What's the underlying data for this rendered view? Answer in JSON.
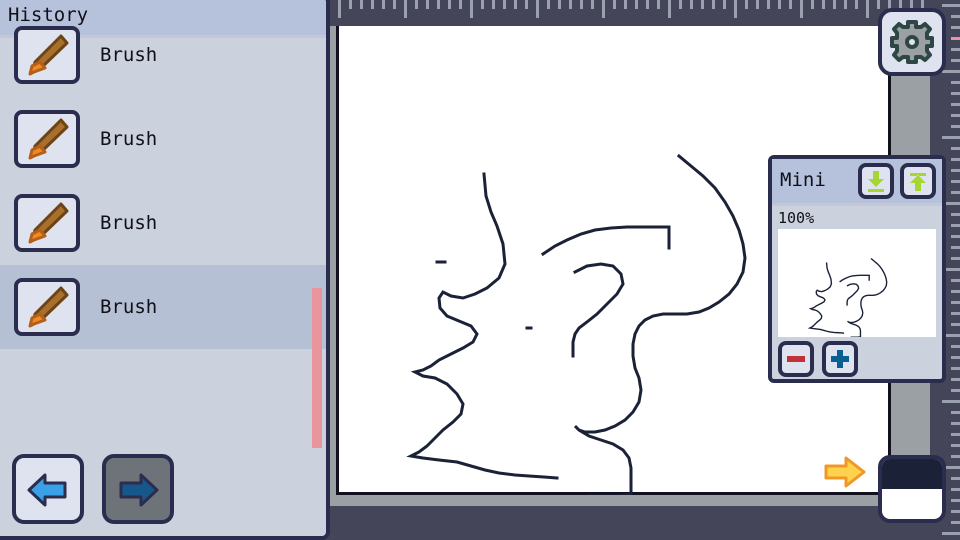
{
  "app": {
    "accent_dark": "#2a2d4d",
    "panel_bg": "#ccd1de",
    "title_bg": "#b6c2dc",
    "selected_bg": "#b6c0d4",
    "scrollbar_color": "#e8969b",
    "canvas_bg": "#ffffff",
    "workspace_bg": "#454559"
  },
  "history": {
    "title": "History",
    "items": [
      {
        "label": "Brush",
        "icon": "brush-icon",
        "selected": false
      },
      {
        "label": "Brush",
        "icon": "brush-icon",
        "selected": false
      },
      {
        "label": "Brush",
        "icon": "brush-icon",
        "selected": false
      },
      {
        "label": "Brush",
        "icon": "brush-icon",
        "selected": true
      }
    ],
    "undo": {
      "name": "undo-button",
      "icon": "undo-arrow-icon",
      "enabled": true
    },
    "redo": {
      "name": "redo-button",
      "icon": "redo-arrow-icon",
      "enabled": false
    }
  },
  "toolbar": {
    "settings": {
      "label": "",
      "icon": "gear-icon"
    }
  },
  "mini": {
    "title": "Mini",
    "zoom_label": "100%",
    "dock_bottom": {
      "icon": "dock-bottom-icon"
    },
    "dock_top": {
      "icon": "dock-top-icon"
    },
    "zoom_out": {
      "icon": "minus-icon"
    },
    "zoom_in": {
      "icon": "plus-icon"
    }
  },
  "canvas": {
    "next_arrow": {
      "icon": "arrow-right-icon"
    },
    "color_swatch": {
      "top_color": "#1b2238",
      "bottom_color": "#ffffff"
    }
  },
  "rulers": {
    "top": {
      "minor_spacing": 11,
      "major_every": 6
    },
    "right": {
      "minor_spacing": 11,
      "major_every": 6,
      "marker_color": "#e8969b"
    }
  }
}
